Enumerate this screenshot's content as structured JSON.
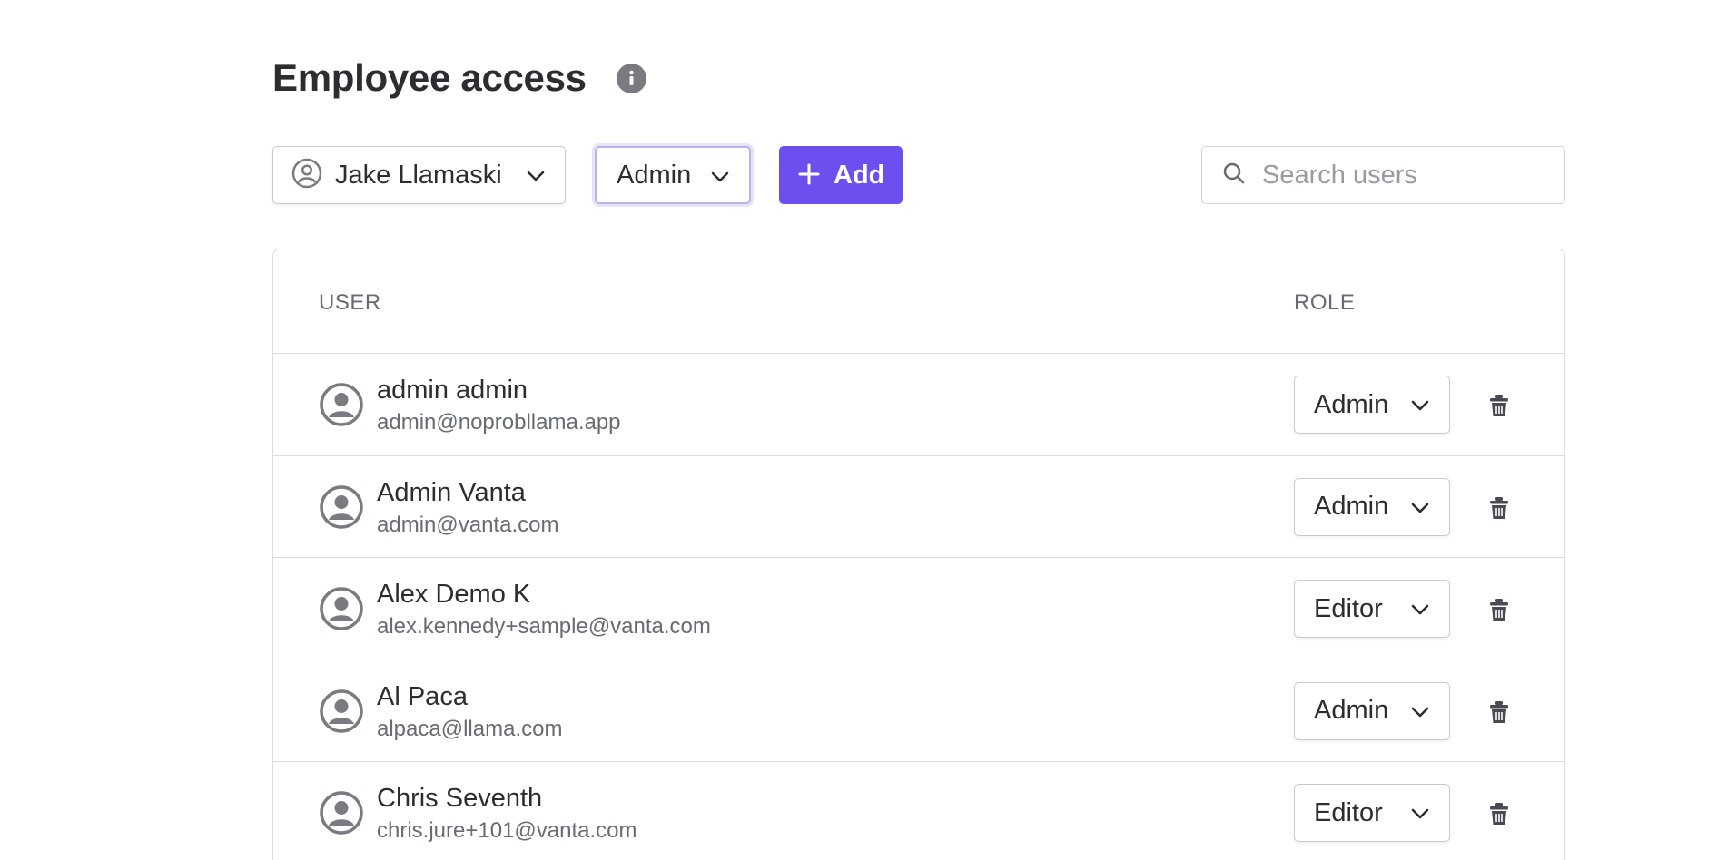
{
  "header": {
    "title": "Employee access",
    "info_icon": "info-icon"
  },
  "toolbar": {
    "user_select": {
      "value": "Jake Llamaski",
      "icon": "user-circle-icon"
    },
    "role_select": {
      "value": "Admin"
    },
    "add_button": {
      "label": "Add",
      "icon": "plus-icon"
    },
    "search": {
      "placeholder": "Search users",
      "value": "",
      "icon": "search-icon"
    }
  },
  "table": {
    "columns": {
      "user": "USER",
      "role": "ROLE"
    },
    "rows": [
      {
        "name": "admin admin",
        "email": "admin@noprobllama.app",
        "role": "Admin"
      },
      {
        "name": "Admin Vanta",
        "email": "admin@vanta.com",
        "role": "Admin"
      },
      {
        "name": "Alex Demo K",
        "email": "alex.kennedy+sample@vanta.com",
        "role": "Editor"
      },
      {
        "name": "Al Paca",
        "email": "alpaca@llama.com",
        "role": "Admin"
      },
      {
        "name": "Chris Seventh",
        "email": "chris.jure+101@vanta.com",
        "role": "Editor"
      }
    ]
  },
  "colors": {
    "accent": "#6d4ff0",
    "text": "#2d2d31",
    "muted": "#6a6b72",
    "border": "#dcdce0"
  }
}
